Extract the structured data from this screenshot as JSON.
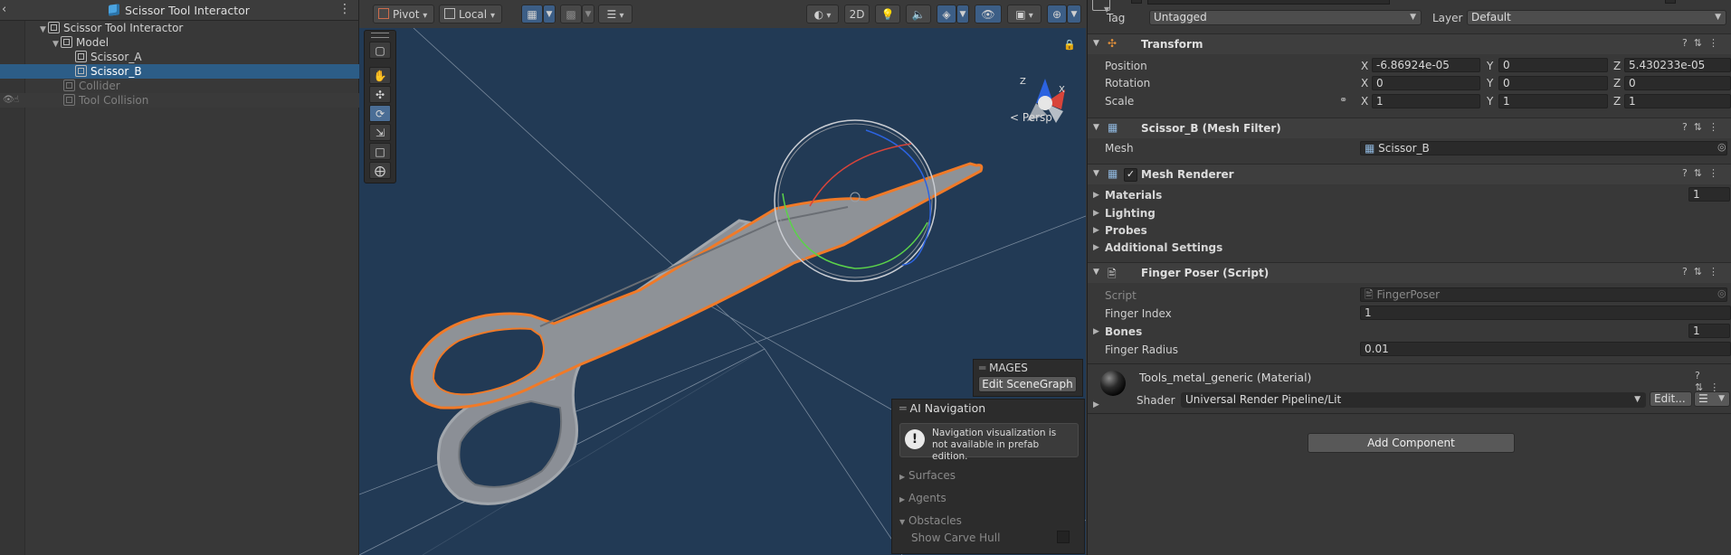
{
  "hierarchy": {
    "title": "Scissor Tool Interactor",
    "menu_icon": "kebab-icon",
    "back_icon": "chevron-left-icon",
    "rows": {
      "root": "Scissor Tool Interactor",
      "model": "Model",
      "scissor_a": "Scissor_A",
      "scissor_b": "Scissor_B",
      "collider": "Collider",
      "tool_collision": "Tool Collision"
    }
  },
  "scene": {
    "toolbar": {
      "pivot": "Pivot",
      "local": "Local",
      "mode_2d": "2D"
    },
    "persp": "Persp",
    "mages": {
      "title": "MAGES",
      "edit_button": "Edit SceneGraph"
    },
    "ai_navigation": {
      "title": "AI Navigation",
      "warning": "Navigation visualization is not available in prefab edition.",
      "surfaces": "Surfaces",
      "agents": "Agents",
      "obstacles": "Obstacles",
      "show_carve_hull": "Show Carve Hull"
    },
    "gizmo_axes": {
      "x": "X",
      "z": "Z"
    }
  },
  "inspector": {
    "tag_label": "Tag",
    "tag_value": "Untagged",
    "layer_label": "Layer",
    "layer_value": "Default",
    "transform": {
      "title": "Transform",
      "position_label": "Position",
      "rotation_label": "Rotation",
      "scale_label": "Scale",
      "axis_x": "X",
      "axis_y": "Y",
      "axis_z": "Z",
      "position": {
        "x": "-6.86924e-05",
        "y": "0",
        "z": "5.430233e-05"
      },
      "rotation": {
        "x": "0",
        "y": "0",
        "z": "0"
      },
      "scale": {
        "x": "1",
        "y": "1",
        "z": "1"
      }
    },
    "mesh_filter": {
      "title": "Scissor_B (Mesh Filter)",
      "mesh_label": "Mesh",
      "mesh_value": "Scissor_B"
    },
    "mesh_renderer": {
      "title": "Mesh Renderer",
      "materials": "Materials",
      "materials_count": "1",
      "lighting": "Lighting",
      "probes": "Probes",
      "additional_settings": "Additional Settings"
    },
    "finger_poser": {
      "title": "Finger Poser (Script)",
      "script_label": "Script",
      "script_value": "FingerPoser",
      "finger_index_label": "Finger Index",
      "finger_index_value": "1",
      "bones_label": "Bones",
      "bones_count": "1",
      "finger_radius_label": "Finger Radius",
      "finger_radius_value": "0.01"
    },
    "material": {
      "name": "Tools_metal_generic (Material)",
      "shader_label": "Shader",
      "shader_value": "Universal Render Pipeline/Lit",
      "edit_button": "Edit..."
    },
    "add_component": "Add Component"
  },
  "colors": {
    "scene_background": "#223a55",
    "selection_outline": "#f07a28",
    "selected_row": "#2c5d87",
    "gizmo_x": "#d8443a",
    "gizmo_y": "#5bd24a",
    "gizmo_z": "#2c63e0"
  }
}
